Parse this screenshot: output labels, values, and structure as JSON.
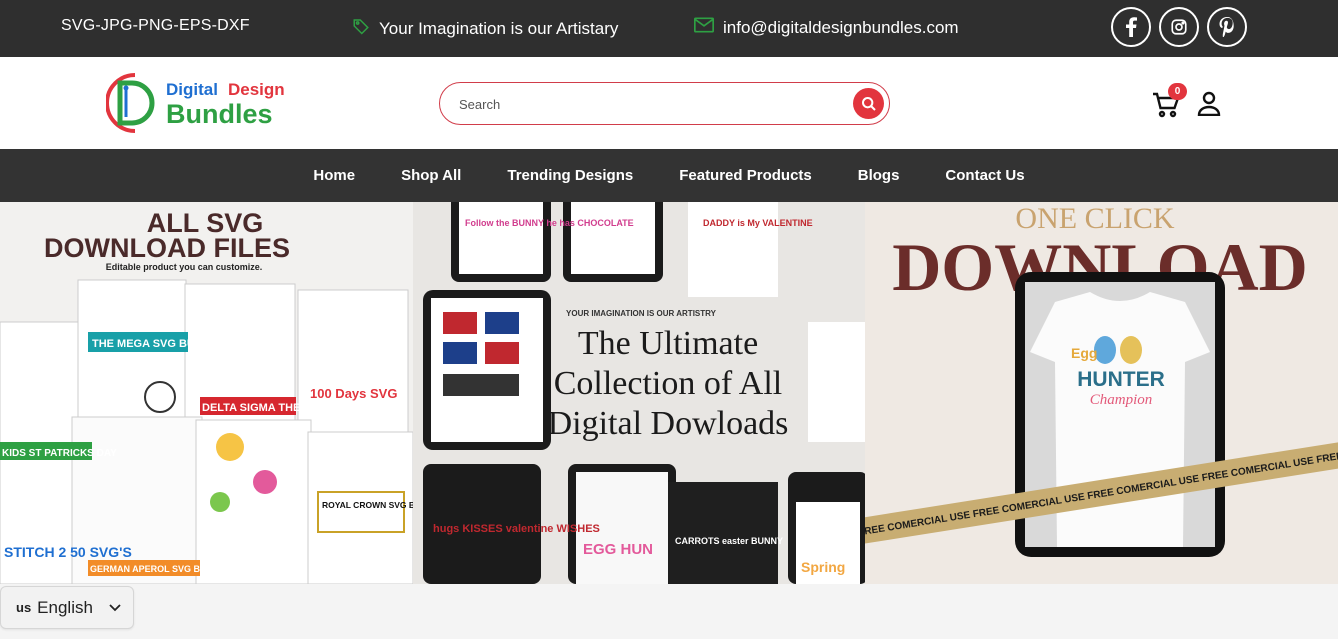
{
  "topbar": {
    "formats": "SVG-JPG-PNG-EPS-DXF",
    "tagline": "Your Imagination is our Artistary",
    "email": "info@digitaldesignbundles.com",
    "social": [
      "facebook-icon",
      "instagram-icon",
      "pinterest-icon"
    ]
  },
  "header": {
    "logo_line1_a": "Digital",
    "logo_line1_b": "Design",
    "logo_line2": "Bundles",
    "search_placeholder": "Search",
    "cart_count": "0"
  },
  "nav": {
    "items": [
      "Home",
      "Shop All",
      "Trending Designs",
      "Featured Products",
      "Blogs",
      "Contact Us"
    ]
  },
  "hero": {
    "panel1": {
      "title_line1": "ALL SVG",
      "title_line2": "DOWNLOAD FILES",
      "subtitle": "Editable product you can customize.",
      "labels": [
        "THE MEGA SVG BU",
        "DELTA SIGMA THETA",
        "100 Days SVG",
        "ROYAL CROWN SVG BUNDLE",
        "KIDS ST PATRICKS DAY",
        "GERMAN APEROL SVG BU",
        "STITCH 2 50 SVG'S"
      ]
    },
    "panel2": {
      "kicker": "YOUR IMAGINATION IS OUR ARTISTRY",
      "title_line1": "The Ultimate",
      "title_line2": "Collection of All",
      "title_line3": "Digital Dowloads",
      "labels": [
        "Follow the BUNNY he has CHOCOLATE",
        "DADDY is My VALENTINE",
        "hugs KISSES valentine WISHES",
        "EGG HUN",
        "CARROTS easter BUNNY",
        "Spring"
      ]
    },
    "panel3": {
      "title_line1": "ONE CLICK",
      "title_line2": "DOWNLOAD",
      "shirt_line1": "Egg",
      "shirt_line2": "HUNTER",
      "shirt_line3": "Champion",
      "ribbon": "FREE COMERCIAL USE FREE COMERCIAL USE FREE COMERCIAL USE FREE COMERCIAL USE FREE COMERCIAL USE"
    }
  },
  "language": {
    "flag": "us",
    "label": "English"
  },
  "colors": {
    "accent": "#e2353e",
    "dark_bar": "#2f2f2f",
    "nav_bar": "#333333",
    "green": "#2ea043",
    "blue": "#1f6fd1"
  }
}
